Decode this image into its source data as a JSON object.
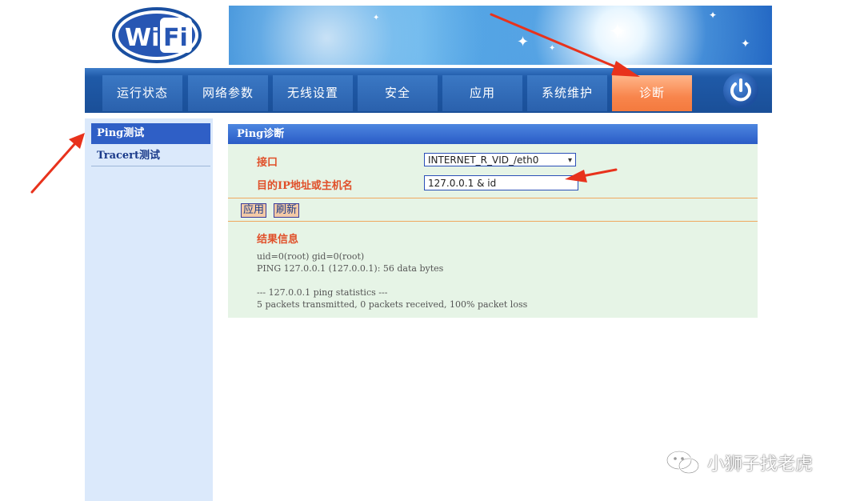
{
  "logo": {
    "text": "WiFi"
  },
  "nav": {
    "items": [
      {
        "label": "运行状态"
      },
      {
        "label": "网络参数"
      },
      {
        "label": "无线设置"
      },
      {
        "label": "安全"
      },
      {
        "label": "应用"
      },
      {
        "label": "系统维护"
      },
      {
        "label": "诊断",
        "active": true
      }
    ],
    "power_icon": "power-icon"
  },
  "sidebar": {
    "items": [
      {
        "label": "Ping测试",
        "active": true
      },
      {
        "label": "Tracert测试"
      }
    ]
  },
  "panel": {
    "title": "Ping诊断",
    "interface_label": "接口",
    "interface_value": "INTERNET_R_VID_/eth0",
    "host_label": "目的IP地址或主机名",
    "host_value": "127.0.0.1 & id",
    "apply_button": "应用",
    "refresh_button": "刷新",
    "result_title": "结果信息",
    "result_lines": [
      "uid=0(root) gid=0(root)",
      "PING 127.0.0.1 (127.0.0.1): 56 data bytes",
      "",
      "--- 127.0.0.1 ping statistics ---",
      "5 packets transmitted, 0 packets received, 100% packet loss"
    ]
  },
  "watermark": {
    "text": "小狮子找老虎",
    "icon": "wechat-icon"
  },
  "colors": {
    "nav_active": "#f8854c",
    "nav_bg": "#1f5aa8",
    "panel_bg": "#e6f4e6",
    "label_orange": "#e0502a",
    "arrow_red": "#e8321c"
  }
}
